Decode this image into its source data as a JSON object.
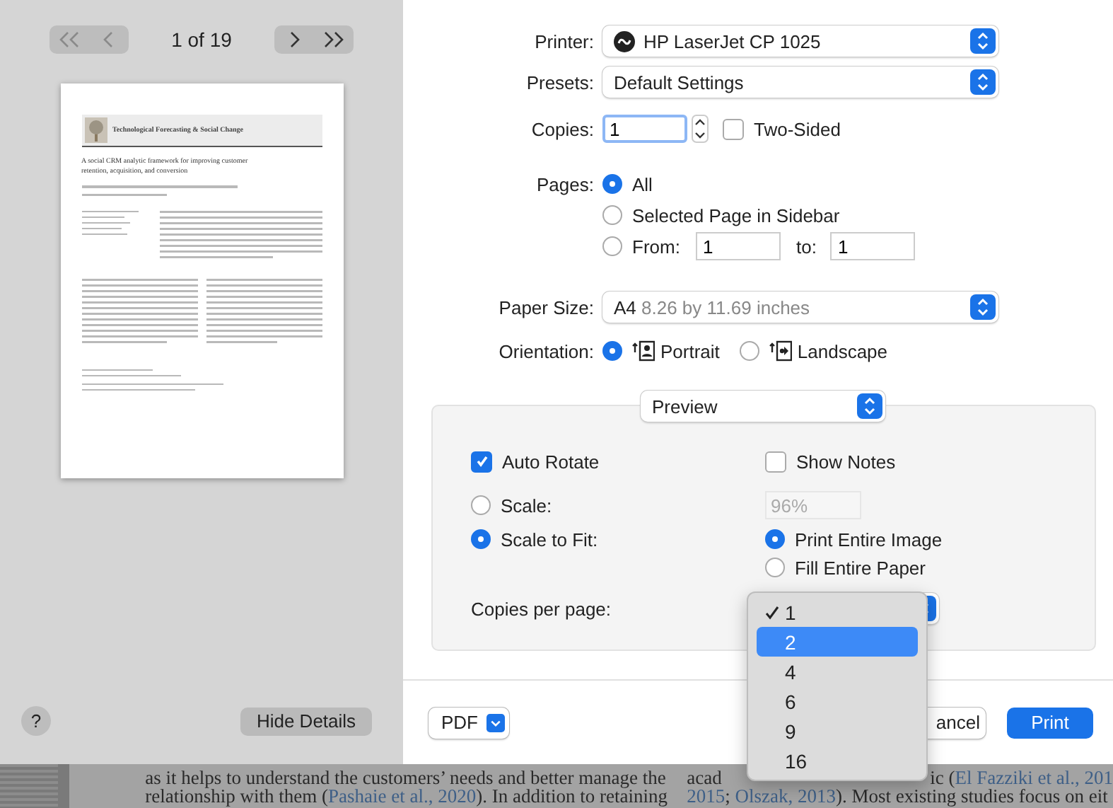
{
  "sidebar": {
    "page_indicator": "1 of 19",
    "page": {
      "journal": "Technological Forecasting & Social Change",
      "title": "A social CRM analytic framework for improving customer retention, acquisition, and conversion"
    },
    "help": "?",
    "hide_details": "Hide Details"
  },
  "printer": {
    "label": "Printer:",
    "value": "HP LaserJet CP 1025"
  },
  "presets": {
    "label": "Presets:",
    "value": "Default Settings"
  },
  "copies": {
    "label": "Copies:",
    "value": "1",
    "two_sided": {
      "label": "Two-Sided",
      "checked": false
    }
  },
  "pages": {
    "label": "Pages:",
    "options": [
      {
        "label": "All",
        "selected": true
      },
      {
        "label": "Selected Page in Sidebar",
        "selected": false
      },
      {
        "label": "From:",
        "selected": false
      }
    ],
    "from": "1",
    "to_label": "to:",
    "to": "1"
  },
  "paper_size": {
    "label": "Paper Size:",
    "value": "A4",
    "detail": "8.26 by 11.69 inches"
  },
  "orientation": {
    "label": "Orientation:",
    "options": [
      {
        "label": "Portrait",
        "kind": "portrait",
        "selected": true
      },
      {
        "label": "Landscape",
        "kind": "landscape",
        "selected": false
      }
    ]
  },
  "section": {
    "value": "Preview",
    "auto_rotate": {
      "label": "Auto Rotate",
      "checked": true
    },
    "show_notes": {
      "label": "Show Notes",
      "checked": false
    },
    "scale_options": [
      {
        "label": "Scale:",
        "selected": false
      },
      {
        "label": "Scale to Fit:",
        "selected": true
      }
    ],
    "scale_value": "96%",
    "fit_options": [
      {
        "label": "Print Entire Image",
        "selected": true
      },
      {
        "label": "Fill Entire Paper",
        "selected": false
      }
    ],
    "copies_per_page": {
      "label": "Copies per page:"
    }
  },
  "menu": [
    {
      "label": "1",
      "checked": true,
      "selected": false
    },
    {
      "label": "2",
      "checked": false,
      "selected": true
    },
    {
      "label": "4",
      "checked": false,
      "selected": false
    },
    {
      "label": "6",
      "checked": false,
      "selected": false
    },
    {
      "label": "9",
      "checked": false,
      "selected": false
    },
    {
      "label": "16",
      "checked": false,
      "selected": false
    }
  ],
  "footer": {
    "pdf": "PDF",
    "cancel": "ancel",
    "print": "Print"
  },
  "background_document": {
    "left_lines": [
      [
        {
          "text": "as it helps to understand the customers’ needs and better manage the",
          "kind": "plain"
        }
      ],
      [
        {
          "text": "relationship with them (",
          "kind": "plain"
        },
        {
          "text": "Pashaie et al., 2020",
          "kind": "link"
        },
        {
          "text": "). In addition to retaining",
          "kind": "plain"
        }
      ]
    ],
    "right_first": "acad",
    "right_first_rest": [
      {
        "text": "ic (",
        "kind": "plain"
      },
      {
        "text": "El Fazziki et al., 201",
        "kind": "link"
      }
    ],
    "right_second": [
      {
        "text": "2015",
        "kind": "link"
      },
      {
        "text": "; ",
        "kind": "plain"
      },
      {
        "text": "Olszak, 2013",
        "kind": "link"
      },
      {
        "text": "). Most existing studies focus on eit",
        "kind": "plain"
      }
    ]
  }
}
